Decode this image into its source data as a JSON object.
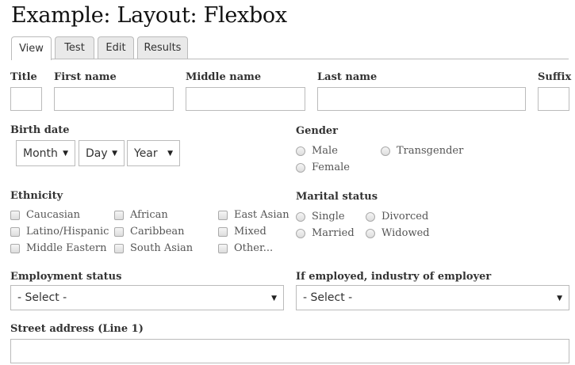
{
  "page": {
    "title": "Example: Layout: Flexbox"
  },
  "tabs": [
    "View",
    "Test",
    "Edit",
    "Results"
  ],
  "fields": {
    "title": "Title",
    "first_name": "First name",
    "middle_name": "Middle name",
    "last_name": "Last name",
    "suffix": "Suffix",
    "birth_date": "Birth date",
    "gender": "Gender",
    "ethnicity": "Ethnicity",
    "marital_status": "Marital status",
    "employment_status": "Employment status",
    "industry": "If employed, industry of employer",
    "street_address": "Street address (Line 1)"
  },
  "birth_date": {
    "month": "Month",
    "day": "Day",
    "year": "Year"
  },
  "gender_options": [
    "Male",
    "Transgender",
    "Female"
  ],
  "ethnicity_options": [
    "Caucasian",
    "African",
    "East Asian",
    "Latino/Hispanic",
    "Caribbean",
    "Mixed",
    "Middle Eastern",
    "South Asian",
    "Other..."
  ],
  "marital_options": [
    "Single",
    "Divorced",
    "Married",
    "Widowed"
  ],
  "employment": {
    "selected": "- Select -"
  },
  "industry": {
    "selected": "- Select -"
  }
}
